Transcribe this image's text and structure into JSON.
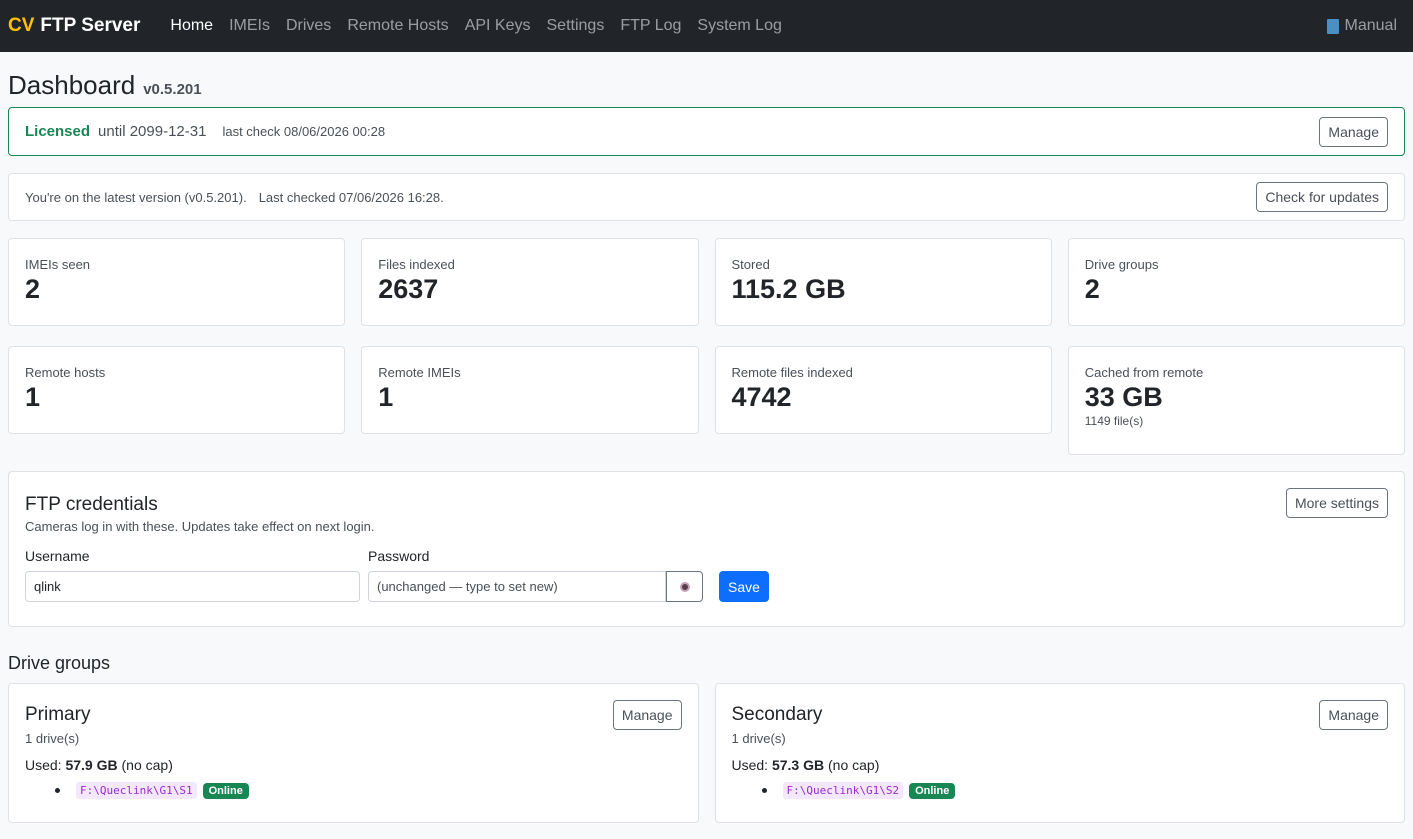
{
  "nav": {
    "brand_cv": "CV",
    "brand_name": "FTP Server",
    "links": [
      "Home",
      "IMEIs",
      "Drives",
      "Remote Hosts",
      "API Keys",
      "Settings",
      "FTP Log",
      "System Log"
    ],
    "manual": "Manual"
  },
  "page": {
    "title": "Dashboard",
    "version": "v0.5.201"
  },
  "license": {
    "status": "Licensed",
    "until": "until 2099-12-31",
    "last_check": "last check 08/06/2026 00:28",
    "manage": "Manage"
  },
  "update": {
    "message": "You're on the latest version (v0.5.201).",
    "last_checked": "Last checked 07/06/2026 16:28.",
    "button": "Check for updates"
  },
  "stats_row1": [
    {
      "label": "IMEIs seen",
      "value": "2"
    },
    {
      "label": "Files indexed",
      "value": "2637"
    },
    {
      "label": "Stored",
      "value": "115.2 GB"
    },
    {
      "label": "Drive groups",
      "value": "2"
    }
  ],
  "stats_row2": [
    {
      "label": "Remote hosts",
      "value": "1"
    },
    {
      "label": "Remote IMEIs",
      "value": "1"
    },
    {
      "label": "Remote files indexed",
      "value": "4742"
    },
    {
      "label": "Cached from remote",
      "value": "33 GB",
      "sub": "1149 file(s)"
    }
  ],
  "ftp": {
    "title": "FTP credentials",
    "desc": "Cameras log in with these. Updates take effect on next login.",
    "more": "More settings",
    "username_label": "Username",
    "username_value": "qlink",
    "password_label": "Password",
    "password_placeholder": "(unchanged — type to set new)",
    "save": "Save"
  },
  "groups": {
    "title": "Drive groups",
    "items": [
      {
        "name": "Primary",
        "count": "1 drive(s)",
        "used_label": "Used:",
        "used": "57.9 GB",
        "cap": "(no cap)",
        "path": "F:\\Queclink\\G1\\S1",
        "status": "Online",
        "manage": "Manage"
      },
      {
        "name": "Secondary",
        "count": "1 drive(s)",
        "used_label": "Used:",
        "used": "57.3 GB",
        "cap": "(no cap)",
        "path": "F:\\Queclink\\G1\\S2",
        "status": "Online",
        "manage": "Manage"
      }
    ]
  },
  "colors": {
    "accent": "#0d6efd",
    "success": "#198754",
    "brand": "#ffc107",
    "navbar": "#212529"
  }
}
